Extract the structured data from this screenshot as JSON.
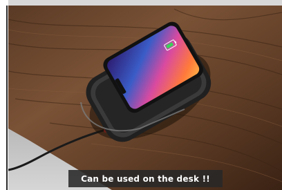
{
  "photo": {
    "subject_icons": [
      "wireless-charger",
      "smartphone",
      "usb-cable",
      "wooden-desk"
    ]
  },
  "caption": {
    "text": "Can be used on the desk !!"
  },
  "colors": {
    "wood_dark": "#3b2415",
    "wood_light": "#7a5236",
    "charger_body": "#2a2a2a",
    "charger_rim": "#6a6a6a",
    "caption_bg": "#282828"
  }
}
